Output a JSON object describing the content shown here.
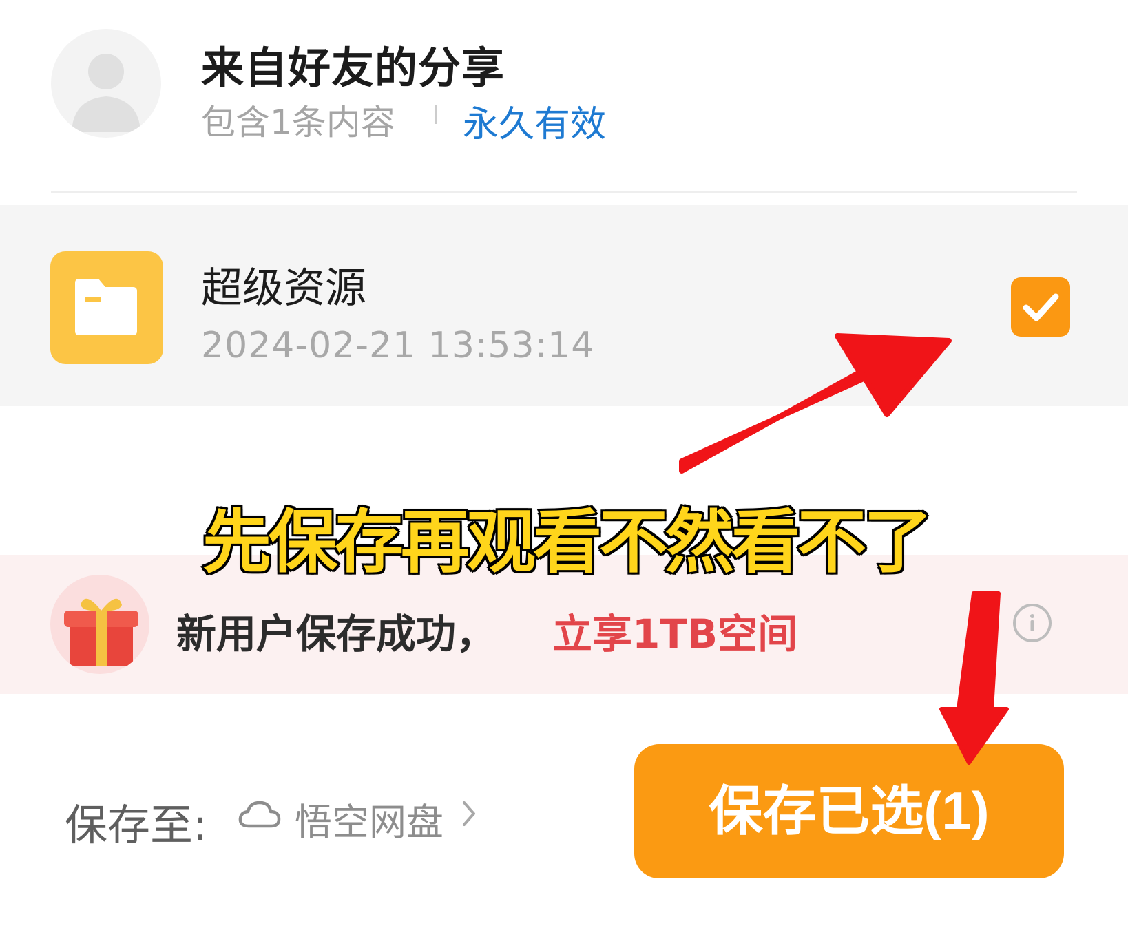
{
  "share": {
    "title": "来自好友的分享",
    "count": "包含1条内容",
    "validity": "永久有效"
  },
  "file": {
    "name": "超级资源",
    "time": "2024-02-21 13:53:14",
    "checked": true,
    "icon": "folder-icon"
  },
  "overlay": {
    "caption": "先保存再观看不然看不了"
  },
  "promo": {
    "text": "新用户保存成功，",
    "highlight": "立享1TB空间",
    "icon": "gift-icon"
  },
  "footer": {
    "save_to_label": "保存至:",
    "drive_name": "悟空网盘",
    "save_button_label": "保存已选(1)"
  },
  "colors": {
    "accent_orange": "#fb9a12",
    "folder_yellow": "#fcc545",
    "link_blue": "#1e7ad2",
    "promo_red": "#e2454a",
    "caption_yellow": "#ffd51b",
    "arrow_red": "#f01418"
  }
}
